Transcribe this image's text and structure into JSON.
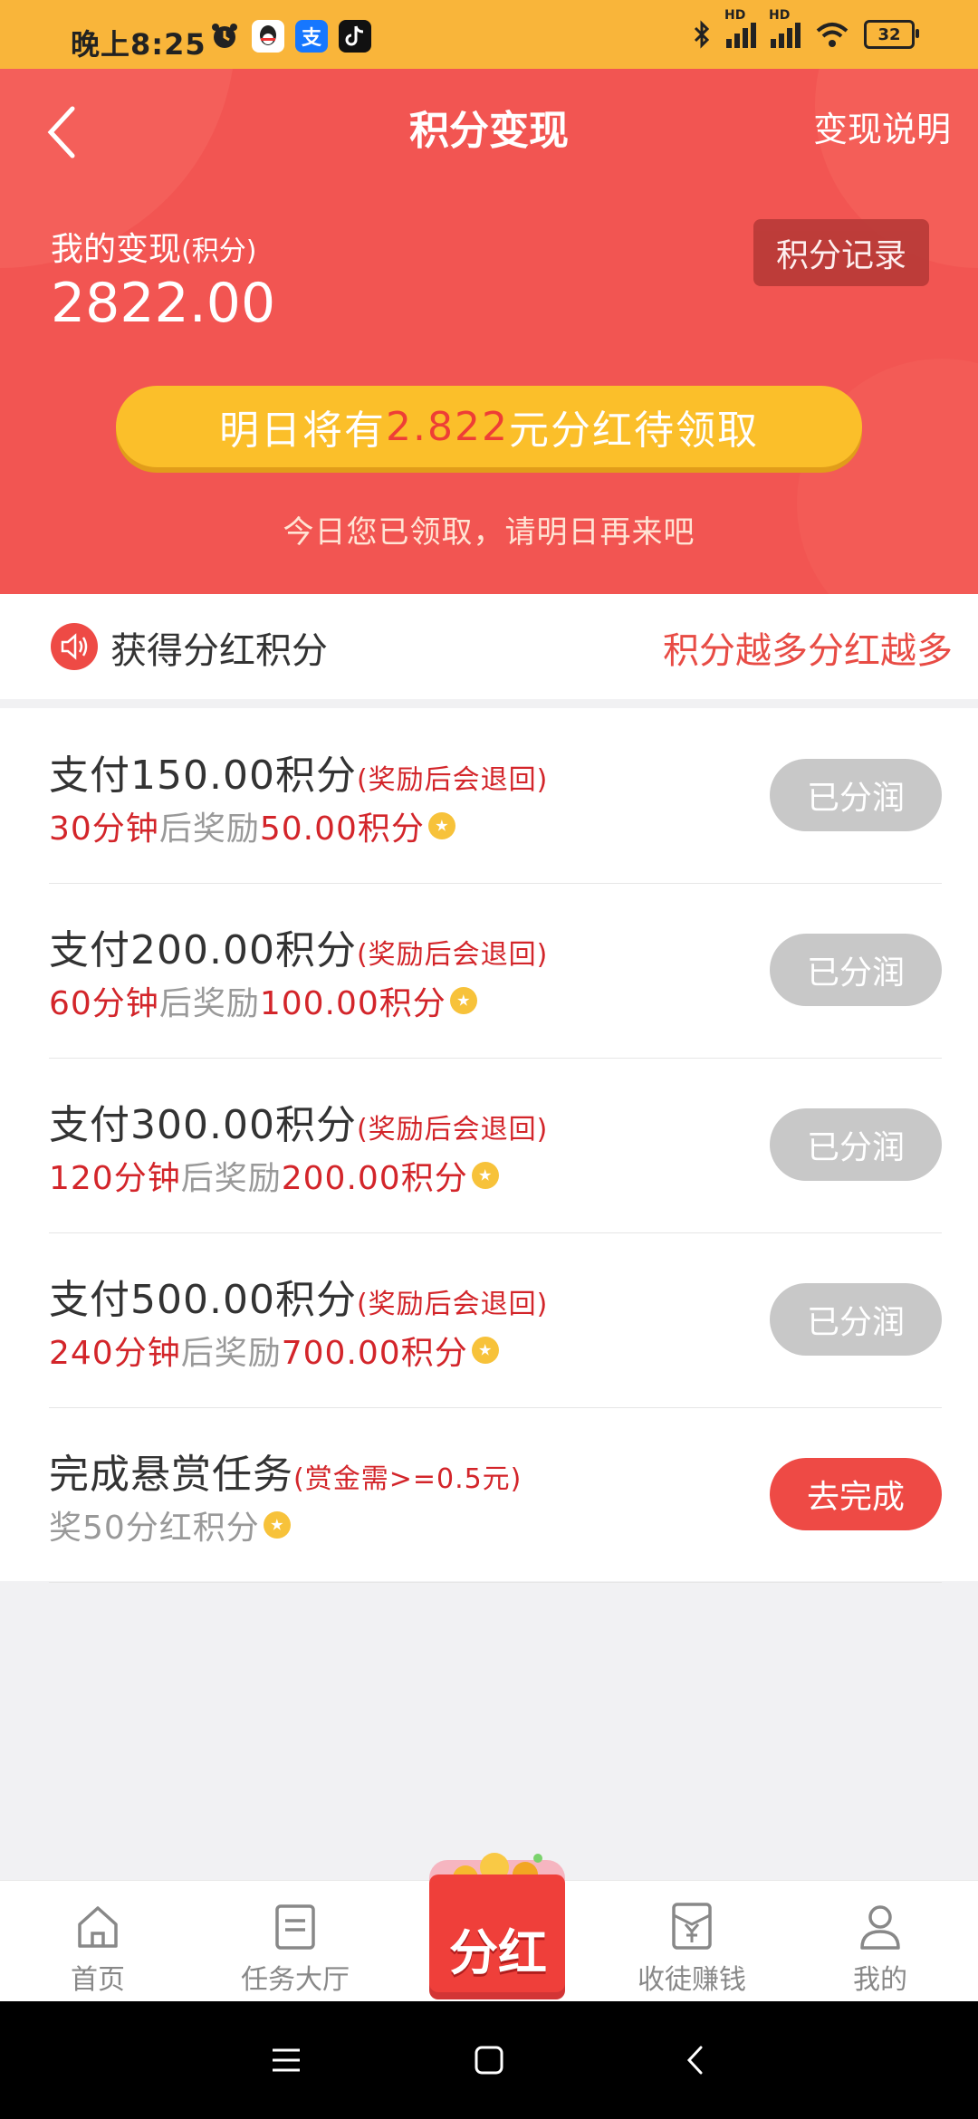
{
  "status_bar": {
    "time": "晚上8:25",
    "apps": [
      "alarm-icon",
      "qq-icon",
      "alipay-icon",
      "tiktok-icon"
    ],
    "alipay_char": "支",
    "battery": "32",
    "network_tag": "HD"
  },
  "header": {
    "title": "积分变现",
    "right_link": "变现说明",
    "my_label": "我的变现",
    "my_label_unit": "(积分)",
    "my_value": "2822.00",
    "record_button": "积分记录",
    "pill_prefix": "明日将有",
    "pill_amount": "2.822",
    "pill_suffix": "元分红待领取",
    "today_notice": "今日您已领取，请明日再来吧"
  },
  "section": {
    "title": "获得分红积分",
    "right_text": "积分越多分红越多"
  },
  "tasks": [
    {
      "pay": "支付150.00积分",
      "note": "(奖励后会退回)",
      "time": "30分钟",
      "mid": "后奖励",
      "reward": "50.00积分",
      "button": "已分润",
      "state": "done"
    },
    {
      "pay": "支付200.00积分",
      "note": "(奖励后会退回)",
      "time": "60分钟",
      "mid": "后奖励",
      "reward": "100.00积分",
      "button": "已分润",
      "state": "done"
    },
    {
      "pay": "支付300.00积分",
      "note": "(奖励后会退回)",
      "time": "120分钟",
      "mid": "后奖励",
      "reward": "200.00积分",
      "button": "已分润",
      "state": "done"
    },
    {
      "pay": "支付500.00积分",
      "note": "(奖励后会退回)",
      "time": "240分钟",
      "mid": "后奖励",
      "reward": "700.00积分",
      "button": "已分润",
      "state": "done"
    },
    {
      "pay": "完成悬赏任务",
      "note": "(赏金需>=0.5元)",
      "time": "",
      "mid": "奖50分红积分",
      "reward": "",
      "button": "去完成",
      "state": "go"
    }
  ],
  "bottom_nav": {
    "home": "首页",
    "tasks": "任务大厅",
    "center": "分红",
    "recruit": "收徒赚钱",
    "mine": "我的"
  },
  "colors": {
    "status_bar": "#f9b53a",
    "header_red": "#f25552",
    "accent_red": "#d3252a",
    "pill_yellow": "#fbbf2a",
    "done_grey": "#c8c8c8"
  }
}
